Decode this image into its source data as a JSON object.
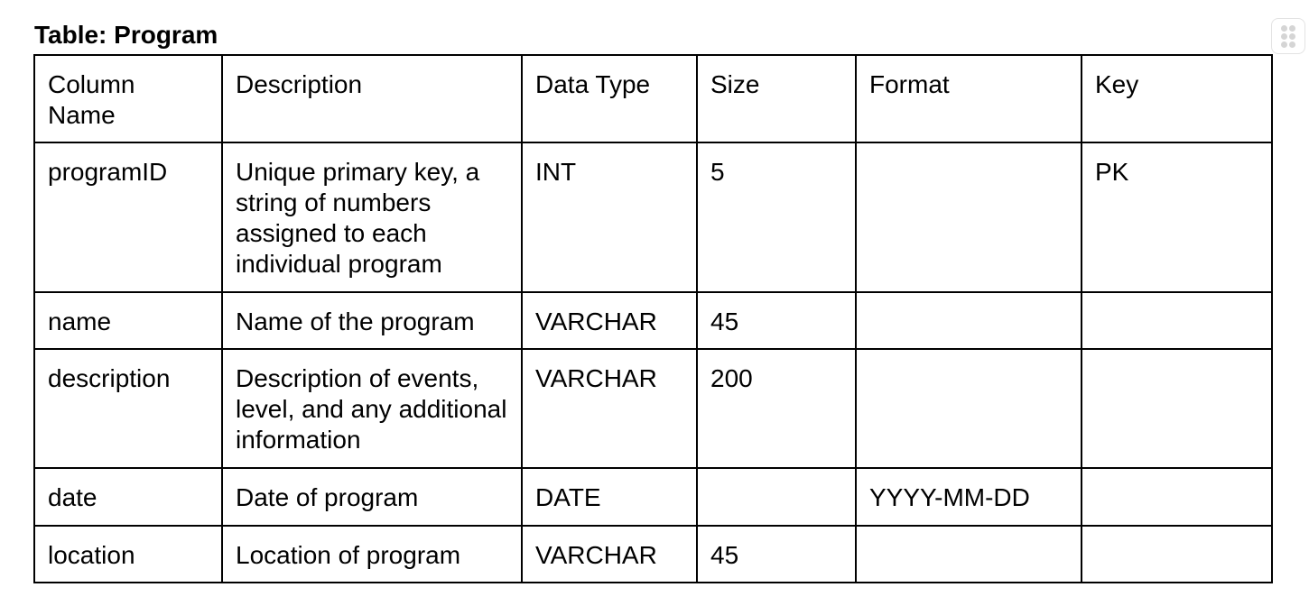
{
  "table_title": "Table: Program",
  "columns": [
    "Column Name",
    "Description",
    "Data Type",
    "Size",
    "Format",
    "Key"
  ],
  "rows": [
    [
      "programID",
      "Unique primary key, a string of numbers assigned to each individual program",
      "INT",
      "5",
      "",
      "PK"
    ],
    [
      "name",
      "Name of the program",
      "VARCHAR",
      "45",
      "",
      ""
    ],
    [
      "description",
      "Description of events, level, and any additional information",
      "VARCHAR",
      "200",
      "",
      ""
    ],
    [
      "date",
      "Date of program",
      "DATE",
      "",
      "YYYY-MM-DD",
      ""
    ],
    [
      "location",
      "Location of program",
      "VARCHAR",
      "45",
      "",
      ""
    ]
  ],
  "icons": {
    "drag_handle": "drag-handle-icon"
  }
}
